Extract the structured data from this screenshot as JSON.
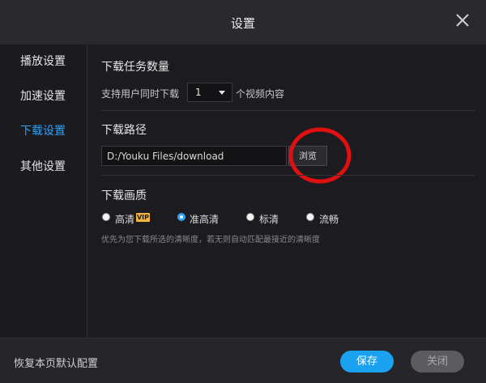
{
  "window": {
    "title": "设置"
  },
  "sidebar": {
    "items": [
      {
        "label": "播放设置"
      },
      {
        "label": "加速设置"
      },
      {
        "label": "下载设置",
        "active": true
      },
      {
        "label": "其他设置"
      }
    ]
  },
  "download_tasks": {
    "title": "下载任务数量",
    "prefix": "支持用户同时下载",
    "selected_value": "1",
    "suffix": "个视频内容"
  },
  "download_path": {
    "title": "下载路径",
    "value": "D:/Youku Files/download",
    "browse_label": "浏览"
  },
  "download_quality": {
    "title": "下载画质",
    "options": [
      {
        "label": "高清",
        "badge": "VIP",
        "checked": false
      },
      {
        "label": "准高清",
        "checked": true
      },
      {
        "label": "标清",
        "checked": false
      },
      {
        "label": "流畅",
        "checked": false
      }
    ],
    "hint": "优先为您下载所选的清晰度，若无则自动匹配最接近的清晰度"
  },
  "footer": {
    "restore_label": "恢复本页默认配置",
    "save_label": "保存",
    "close_label": "关闭"
  },
  "colors": {
    "accent": "#2ea2f8",
    "save_button": "#1aa1f0",
    "vip_badge": "#f5b43a",
    "annotation": "#e01010"
  }
}
